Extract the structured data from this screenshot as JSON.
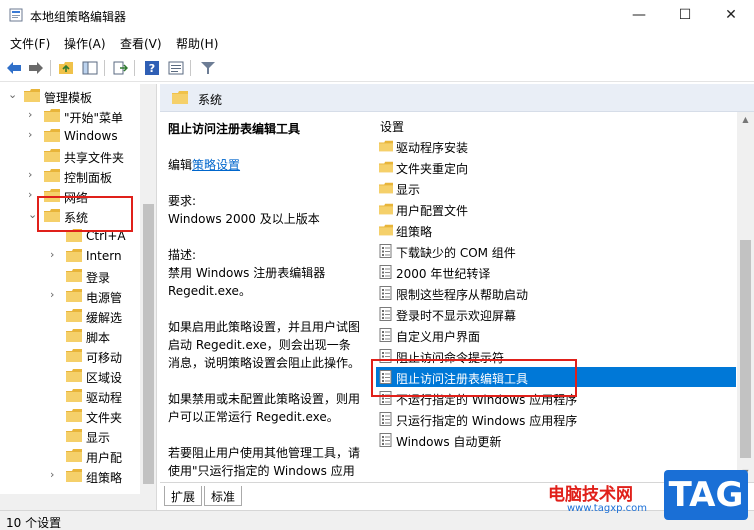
{
  "window": {
    "title": "本地组策略编辑器",
    "minimize": "—",
    "maximize": "☐",
    "close": "✕"
  },
  "menu": [
    "文件(F)",
    "操作(A)",
    "查看(V)",
    "帮助(H)"
  ],
  "tree": [
    {
      "label": "管理模板",
      "expanded": true,
      "indent": 0
    },
    {
      "label": "\"开始\"菜单",
      "expanded": false,
      "indent": 1
    },
    {
      "label": "Windows",
      "expanded": false,
      "indent": 1
    },
    {
      "label": "共享文件夹",
      "expanded": null,
      "indent": 1
    },
    {
      "label": "控制面板",
      "expanded": false,
      "indent": 1
    },
    {
      "label": "网络",
      "expanded": false,
      "indent": 1
    },
    {
      "label": "系统",
      "expanded": true,
      "indent": 1
    },
    {
      "label": "Ctrl+A",
      "expanded": null,
      "indent": 2
    },
    {
      "label": "Intern",
      "expanded": false,
      "indent": 2
    },
    {
      "label": "登录",
      "expanded": null,
      "indent": 2
    },
    {
      "label": "电源管",
      "expanded": false,
      "indent": 2
    },
    {
      "label": "缓解选",
      "expanded": null,
      "indent": 2
    },
    {
      "label": "脚本",
      "expanded": null,
      "indent": 2
    },
    {
      "label": "可移动",
      "expanded": null,
      "indent": 2
    },
    {
      "label": "区域设",
      "expanded": null,
      "indent": 2
    },
    {
      "label": "驱动程",
      "expanded": null,
      "indent": 2
    },
    {
      "label": "文件夹",
      "expanded": null,
      "indent": 2
    },
    {
      "label": "显示",
      "expanded": null,
      "indent": 2
    },
    {
      "label": "用户配",
      "expanded": null,
      "indent": 2
    },
    {
      "label": "组策略",
      "expanded": false,
      "indent": 2
    }
  ],
  "header": {
    "title": "系统"
  },
  "description": {
    "title": "阻止访问注册表编辑工具",
    "edit_prefix": "编辑",
    "edit_link": "策略设置",
    "req_label": "要求:",
    "req_value": "Windows 2000 及以上版本",
    "desc_label": "描述:",
    "desc_value": "禁用 Windows 注册表编辑器 Regedit.exe。",
    "p1": "如果启用此策略设置，并且用户试图启动 Regedit.exe，则会出现一条消息，说明策略设置会阻止此操作。",
    "p2": "如果禁用或未配置此策略设置，则用户可以正常运行 Regedit.exe。",
    "p3": "若要阻止用户使用其他管理工具，请使用\"只运行指定的 Windows 应用程序\"策略设置。"
  },
  "list": {
    "header": "设置",
    "items": [
      {
        "label": "驱动程序安装",
        "type": "folder"
      },
      {
        "label": "文件夹重定向",
        "type": "folder"
      },
      {
        "label": "显示",
        "type": "folder"
      },
      {
        "label": "用户配置文件",
        "type": "folder"
      },
      {
        "label": "组策略",
        "type": "folder"
      },
      {
        "label": "下载缺少的 COM 组件",
        "type": "setting"
      },
      {
        "label": "2000 年世纪转译",
        "type": "setting"
      },
      {
        "label": "限制这些程序从帮助启动",
        "type": "setting"
      },
      {
        "label": "登录时不显示欢迎屏幕",
        "type": "setting"
      },
      {
        "label": "自定义用户界面",
        "type": "setting"
      },
      {
        "label": "阻止访问命令提示符",
        "type": "setting"
      },
      {
        "label": "阻止访问注册表编辑工具",
        "type": "setting",
        "selected": true
      },
      {
        "label": "不运行指定的 Windows 应用程序",
        "type": "setting"
      },
      {
        "label": "只运行指定的 Windows 应用程序",
        "type": "setting"
      },
      {
        "label": "Windows 自动更新",
        "type": "setting"
      }
    ]
  },
  "tabs": [
    "扩展",
    "标准"
  ],
  "status": "10 个设置",
  "watermark": {
    "cn": "电脑技术网",
    "tag": "TAG",
    "url": "www.tagxp.com"
  },
  "colors": {
    "selection": "#0078d7",
    "highlight_box": "#e0201a",
    "folder": "#f0c24a",
    "link": "#0066cc"
  }
}
